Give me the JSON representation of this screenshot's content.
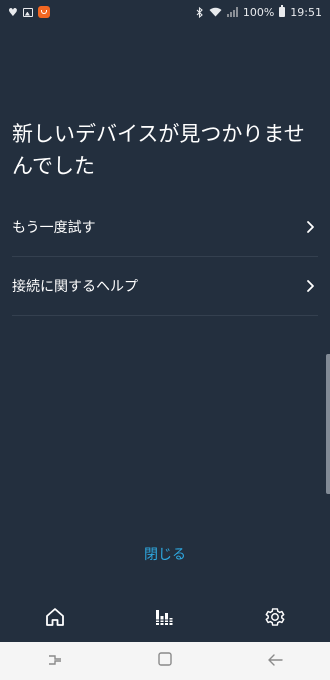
{
  "status_bar": {
    "battery_text": "100%",
    "time": "19:51",
    "icons": [
      "heart-icon",
      "image-icon",
      "app-badge-icon",
      "bluetooth-icon",
      "wifi-icon",
      "signal-icon",
      "battery-icon"
    ]
  },
  "screen": {
    "title": "新しいデバイスが見つかりませんでした",
    "options": [
      {
        "label": "もう一度試す",
        "icon": "chevron-right-icon"
      },
      {
        "label": "接続に関するヘルプ",
        "icon": "chevron-right-icon"
      }
    ],
    "close_label": "閉じる"
  },
  "bottom_nav": {
    "items": [
      {
        "name": "home",
        "icon": "home-icon"
      },
      {
        "name": "play",
        "icon": "equalizer-icon"
      },
      {
        "name": "settings",
        "icon": "gear-icon"
      }
    ]
  },
  "system_nav": {
    "items": [
      "recents-icon",
      "home-square-icon",
      "back-icon"
    ]
  },
  "colors": {
    "background": "#232f3e",
    "accent": "#2ea8e0",
    "divider": "#34404f",
    "text": "#ffffff"
  }
}
